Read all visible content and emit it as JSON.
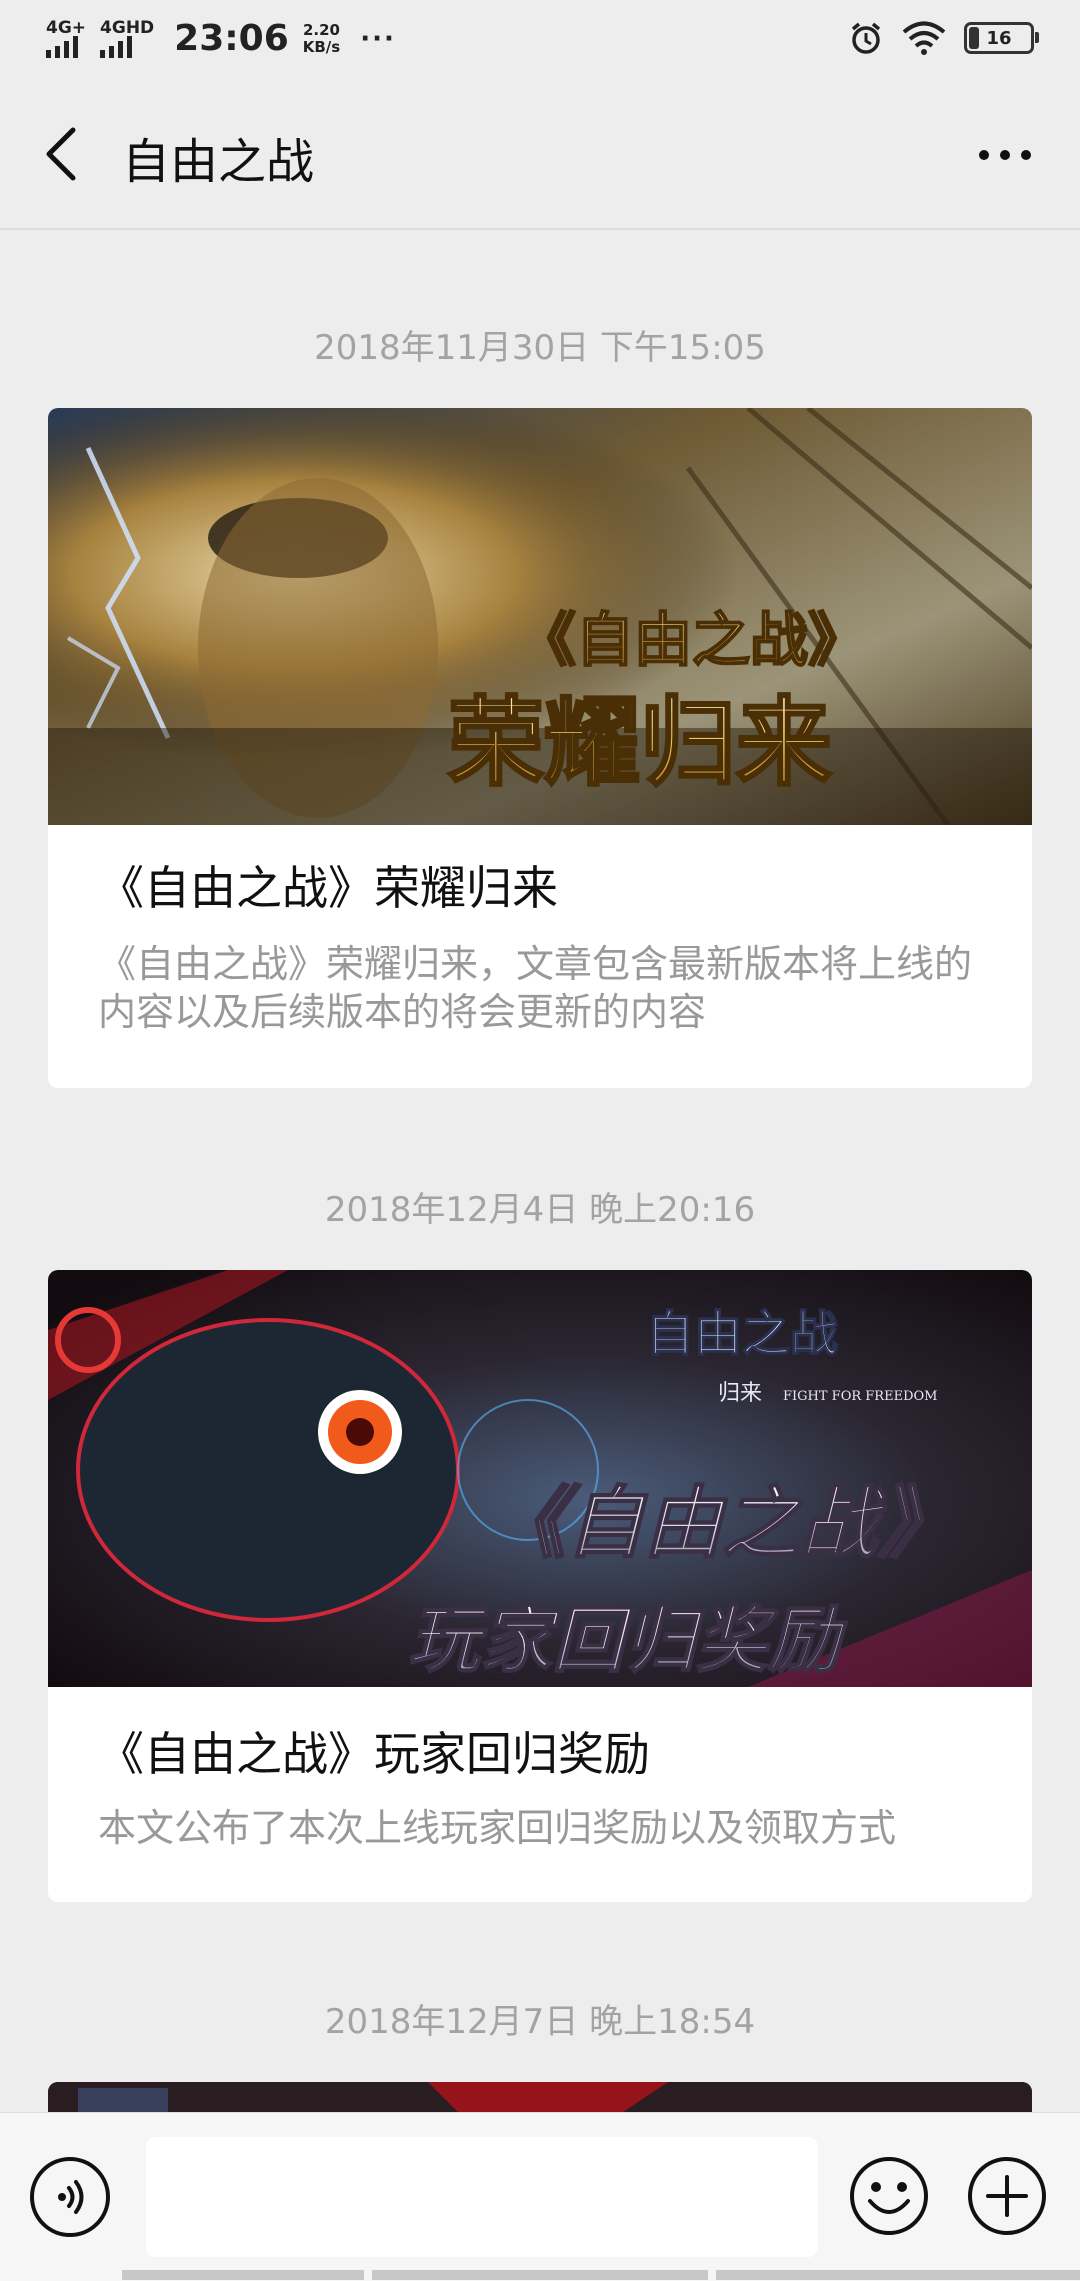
{
  "status_bar": {
    "network1": "4G+",
    "network2": "4GHD",
    "time": "23:06",
    "speed_value": "2.20",
    "speed_unit": "KB/s",
    "overflow": "···",
    "battery": "16",
    "battery_level": 0.16
  },
  "nav": {
    "title": "自由之战"
  },
  "messages": [
    {
      "timestamp": "2018年11月30日 下午15:05",
      "cover_text1": "《自由之战》",
      "cover_text2": "荣耀归来",
      "title": "《自由之战》荣耀归来",
      "desc": "《自由之战》荣耀归来，文章包含最新版本将上线的内容以及后续版本的将会更新的内容"
    },
    {
      "timestamp": "2018年12月4日 晚上20:16",
      "cover_logo": "自由之战",
      "cover_logo_sub": "归来",
      "cover_logo_en": "FIGHT FOR FREEDOM",
      "cover_text1": "《自由之战》",
      "cover_text2": "玩家回归奖励",
      "title": "《自由之战》玩家回归奖励",
      "desc": "本文公布了本次上线玩家回归奖励以及领取方式"
    },
    {
      "timestamp": "2018年12月7日 晚上18:54"
    }
  ],
  "input": {
    "value": ""
  },
  "icons": {
    "back": "chevron-left-icon",
    "more": "more-dots-icon",
    "voice": "voice-icon",
    "emoji": "emoji-icon",
    "plus": "plus-icon",
    "alarm": "alarm-icon",
    "wifi": "wifi-icon"
  }
}
